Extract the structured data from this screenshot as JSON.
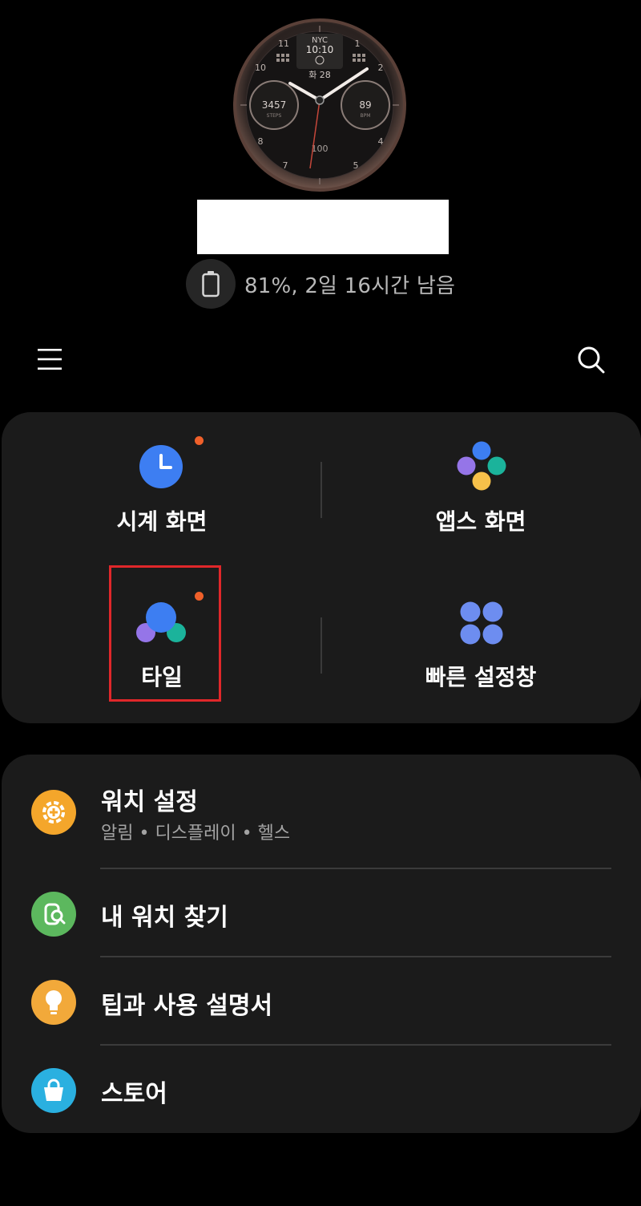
{
  "watch_face": {
    "city": "NYC",
    "time": "10:10",
    "date": "화 28",
    "steps_value": "3457",
    "steps_label": "STEPS",
    "heart_value": "89",
    "heart_label": "BPM",
    "battery_value": "100",
    "hour_numbers": [
      "11",
      "1",
      "2",
      "4",
      "5",
      "7",
      "8",
      "10"
    ]
  },
  "battery": {
    "status_text": "81%, 2일 16시간 남음"
  },
  "grid": {
    "watch_faces_label": "시계 화면",
    "apps_label": "앱스 화면",
    "tiles_label": "타일",
    "quick_panel_label": "빠른 설정창"
  },
  "list": {
    "watch_settings_title": "워치 설정",
    "watch_settings_sub": "알림 • 디스플레이 • 헬스",
    "find_watch_title": "내 워치 찾기",
    "tips_title": "팁과 사용 설명서",
    "store_title": "스토어"
  },
  "colors": {
    "background": "#000000",
    "card": "#1b1b1b",
    "badge": "#f0602a",
    "highlight": "#e0272a",
    "clock_blue": "#3d7ef2",
    "settings_orange": "#f4a62b",
    "find_green": "#5cb85e",
    "tips_yellow": "#f2a93a",
    "store_cyan": "#2ab0e0"
  }
}
